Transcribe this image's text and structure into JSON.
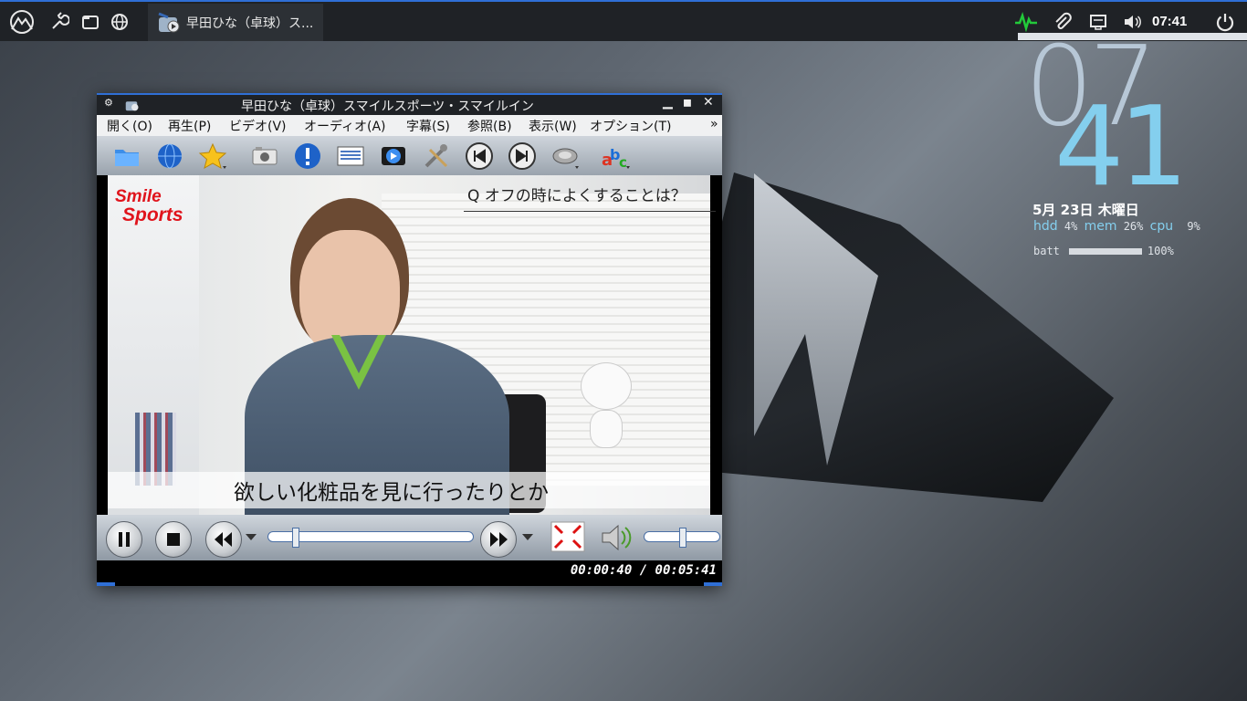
{
  "taskbar": {
    "task_title": "早田ひな（卓球）ス...",
    "clock": "07:41",
    "icons": [
      "mountain-menu-icon",
      "wrench-icon",
      "window-icon",
      "globe-icon",
      "activity-icon",
      "paperclip-icon",
      "network-icon",
      "volume-icon",
      "power-icon"
    ]
  },
  "desktop_widget": {
    "hour": "07",
    "minute": "41",
    "date": "5月 23日 木曜日",
    "hdd_label": "hdd",
    "hdd_value": "4%",
    "mem_label": "mem",
    "mem_value": "26%",
    "cpu_label": "cpu",
    "cpu_value": "9%",
    "batt_label": "batt",
    "batt_value": "100%",
    "batt_level": 1.0
  },
  "player": {
    "window_title": "早田ひな（卓球）スマイルスポーツ・スマイルイン",
    "menu": [
      "開く(O)",
      "再生(P)",
      "ビデオ(V)",
      "オーディオ(A)",
      "字幕(S)",
      "参照(B)",
      "表示(W)",
      "オプション(T)"
    ],
    "menu_more": "»",
    "video": {
      "logo_line1": "Smile",
      "logo_line2": "Sports",
      "question": "Q オフの時によくすることは？",
      "subtitle": "欲しい化粧品を見に行ったりとか"
    },
    "time_display": "00:00:40 / 00:05:41",
    "seek_fraction": 0.117,
    "volume_fraction": 0.5,
    "colors": {
      "accent": "#2f6fd6",
      "widget_blue": "#84cfee"
    }
  }
}
